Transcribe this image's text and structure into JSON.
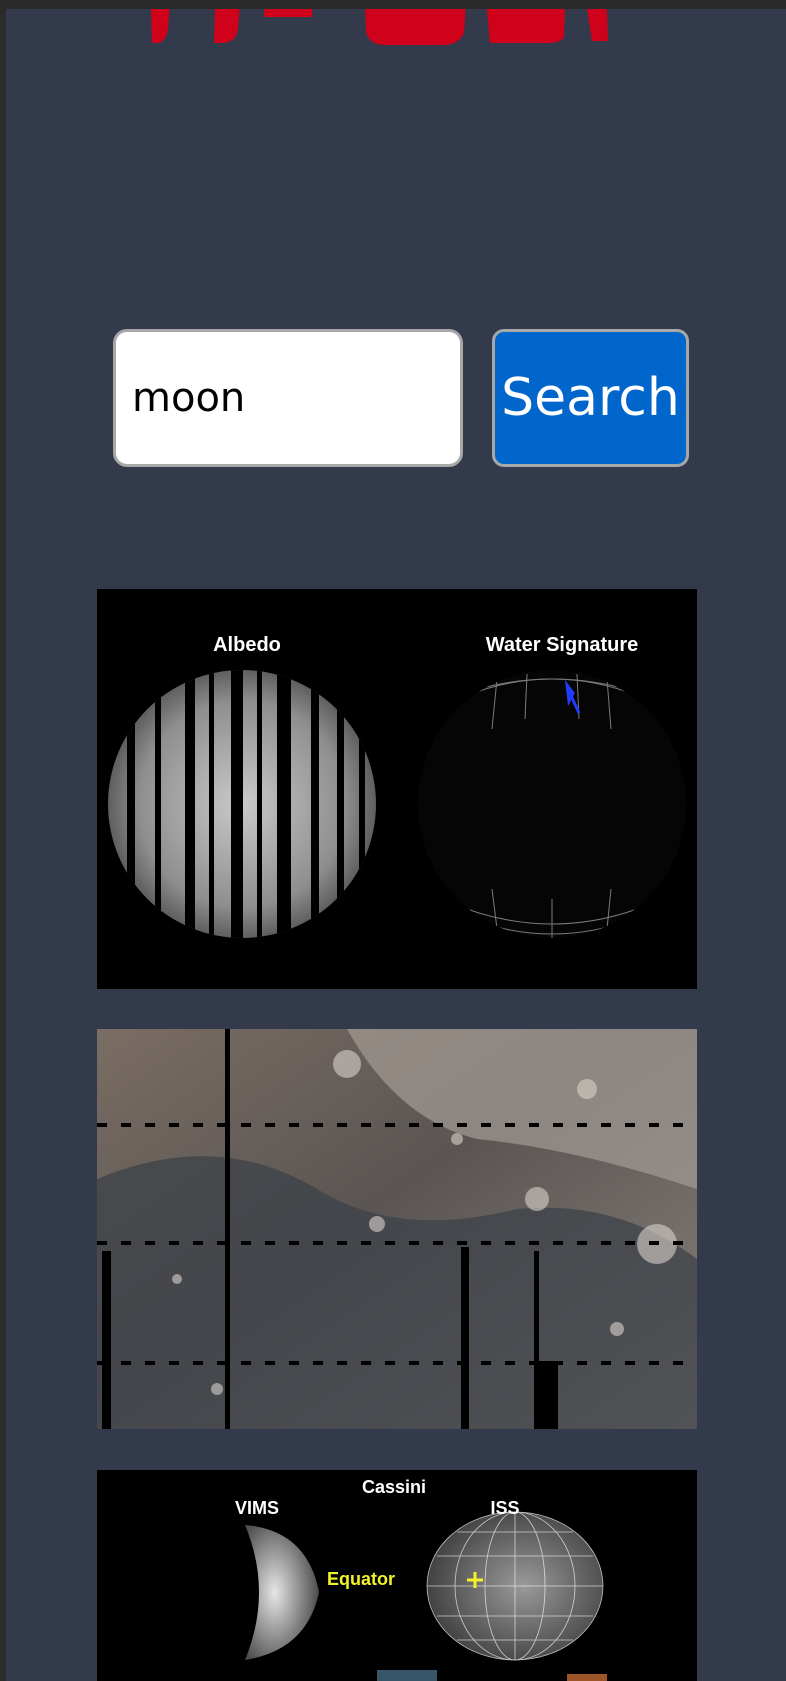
{
  "search": {
    "value": "moon",
    "button_label": "Search"
  },
  "results": [
    {
      "labels": {
        "left": "Albedo",
        "right": "Water Signature"
      }
    },
    {
      "labels": {}
    },
    {
      "labels": {
        "title": "Cassini",
        "left": "VIMS",
        "right": "ISS",
        "equator": "Equator"
      }
    }
  ],
  "colors": {
    "page_bg": "#333a4c",
    "button_bg": "#0066cc",
    "logo_red": "#d0021b"
  }
}
